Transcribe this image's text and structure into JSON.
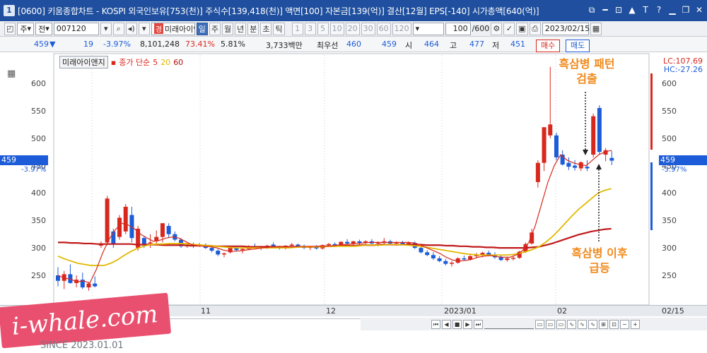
{
  "window": {
    "id_badge": "1",
    "title": "[0600] 키움종합차트 - KOSPI 외국인보유[753(천)] 주식수[139,418(천)] 액면[100] 자본금[139(억)] 결산[12월] EPS[-140] 시가총액[640(억)]",
    "controls": [
      "⧉",
      "━",
      "⊡",
      "▲",
      "T",
      "?",
      "▁",
      "❐",
      "✕"
    ]
  },
  "toolbar": {
    "period_select": "주",
    "jeon_select": "전",
    "stock_code": "007120",
    "gyung_badge": "경",
    "stock_name": "미래아이앤",
    "period_buttons": [
      "일",
      "주",
      "월",
      "년",
      "분",
      "초",
      "틱"
    ],
    "active_period": "일",
    "interval_buttons": [
      "1",
      "3",
      "5",
      "10",
      "20",
      "30",
      "60",
      "120"
    ],
    "count": "100",
    "count_total": "/600",
    "date": "2023/02/15"
  },
  "info": {
    "price": "459",
    "change": "19",
    "change_pct": "-3.97%",
    "volume": "8,101,248",
    "vol_ratio": "73.41%",
    "turnover": "5.81%",
    "amount": "3,733백만",
    "best_bid_label": "최우선",
    "best_ask": "460",
    "best_bid": "459",
    "open_label": "시",
    "open": "464",
    "high_label": "고",
    "high": "477",
    "low_label": "저",
    "low": "451",
    "buy_label": "매수",
    "sell_label": "매도"
  },
  "legend": {
    "name": "미래아이앤지",
    "ma_label": "종가 단순",
    "ma5": "5",
    "ma20": "20",
    "ma60": "60"
  },
  "price_axis": {
    "ticks": [
      "600",
      "550",
      "500",
      "450",
      "400",
      "350",
      "300",
      "250"
    ],
    "current_price": "459",
    "current_change": "-3.97%"
  },
  "lc_hc": {
    "lc": "LC:107.69",
    "hc": "HC:-27.26"
  },
  "date_axis": [
    "11",
    "12",
    "2023/01",
    "02",
    "02/15"
  ],
  "annotations": {
    "pattern_detected": "흑삼병 패턴\n검출",
    "after_surge": "흑삼병 이후\n급등"
  },
  "watermark": {
    "text": "i-whale.com",
    "since": "SINCE 2023.01.01"
  },
  "colors": {
    "title_bg": "#1f4f9e",
    "up": "#d8281e",
    "down": "#1c5cd8",
    "ma5": "#d8281e",
    "ma20": "#e3b800",
    "ma60": "#c0191a",
    "annotation": "#f08a1c",
    "watermark_bg": "#e9506f"
  },
  "chart_data": {
    "type": "candlestick",
    "y_range": [
      210,
      640
    ],
    "candles": [
      {
        "o": 250,
        "h": 265,
        "l": 230,
        "c": 240
      },
      {
        "o": 240,
        "h": 258,
        "l": 225,
        "c": 252
      },
      {
        "o": 252,
        "h": 270,
        "l": 235,
        "c": 236
      },
      {
        "o": 236,
        "h": 250,
        "l": 228,
        "c": 242
      },
      {
        "o": 242,
        "h": 255,
        "l": 225,
        "c": 228
      },
      {
        "o": 228,
        "h": 238,
        "l": 222,
        "c": 235
      },
      {
        "o": 235,
        "h": 248,
        "l": 228,
        "c": 230
      },
      {
        "o": 306,
        "h": 312,
        "l": 300,
        "c": 306
      },
      {
        "o": 310,
        "h": 395,
        "l": 305,
        "c": 390
      },
      {
        "o": 330,
        "h": 335,
        "l": 300,
        "c": 308
      },
      {
        "o": 320,
        "h": 360,
        "l": 315,
        "c": 355
      },
      {
        "o": 330,
        "h": 380,
        "l": 325,
        "c": 375
      },
      {
        "o": 360,
        "h": 375,
        "l": 310,
        "c": 318
      },
      {
        "o": 300,
        "h": 340,
        "l": 295,
        "c": 335
      },
      {
        "o": 318,
        "h": 322,
        "l": 300,
        "c": 305
      },
      {
        "o": 308,
        "h": 325,
        "l": 300,
        "c": 310
      },
      {
        "o": 312,
        "h": 332,
        "l": 305,
        "c": 320
      },
      {
        "o": 320,
        "h": 345,
        "l": 310,
        "c": 345
      },
      {
        "o": 340,
        "h": 345,
        "l": 318,
        "c": 325
      },
      {
        "o": 325,
        "h": 330,
        "l": 312,
        "c": 315
      },
      {
        "o": 315,
        "h": 318,
        "l": 300,
        "c": 303
      },
      {
        "o": 303,
        "h": 310,
        "l": 300,
        "c": 306
      },
      {
        "o": 306,
        "h": 310,
        "l": 300,
        "c": 304
      },
      {
        "o": 305,
        "h": 309,
        "l": 302,
        "c": 306
      },
      {
        "o": 305,
        "h": 308,
        "l": 298,
        "c": 300
      },
      {
        "o": 300,
        "h": 304,
        "l": 292,
        "c": 295
      },
      {
        "o": 295,
        "h": 298,
        "l": 285,
        "c": 288
      },
      {
        "o": 288,
        "h": 292,
        "l": 283,
        "c": 290
      },
      {
        "o": 292,
        "h": 302,
        "l": 290,
        "c": 300
      },
      {
        "o": 300,
        "h": 303,
        "l": 294,
        "c": 296
      },
      {
        "o": 296,
        "h": 300,
        "l": 290,
        "c": 298
      },
      {
        "o": 298,
        "h": 305,
        "l": 296,
        "c": 303
      },
      {
        "o": 303,
        "h": 308,
        "l": 299,
        "c": 300
      },
      {
        "o": 300,
        "h": 304,
        "l": 296,
        "c": 302
      },
      {
        "o": 302,
        "h": 306,
        "l": 298,
        "c": 304
      },
      {
        "o": 306,
        "h": 310,
        "l": 300,
        "c": 302
      },
      {
        "o": 302,
        "h": 304,
        "l": 297,
        "c": 299
      },
      {
        "o": 299,
        "h": 305,
        "l": 297,
        "c": 304
      },
      {
        "o": 304,
        "h": 309,
        "l": 301,
        "c": 306
      },
      {
        "o": 306,
        "h": 308,
        "l": 302,
        "c": 303
      },
      {
        "o": 303,
        "h": 306,
        "l": 298,
        "c": 300
      },
      {
        "o": 300,
        "h": 304,
        "l": 296,
        "c": 302
      },
      {
        "o": 302,
        "h": 305,
        "l": 297,
        "c": 299
      },
      {
        "o": 299,
        "h": 306,
        "l": 297,
        "c": 305
      },
      {
        "o": 305,
        "h": 309,
        "l": 302,
        "c": 307
      },
      {
        "o": 307,
        "h": 310,
        "l": 302,
        "c": 304
      },
      {
        "o": 304,
        "h": 312,
        "l": 303,
        "c": 311
      },
      {
        "o": 311,
        "h": 316,
        "l": 305,
        "c": 308
      },
      {
        "o": 308,
        "h": 313,
        "l": 305,
        "c": 312
      },
      {
        "o": 312,
        "h": 315,
        "l": 306,
        "c": 309
      },
      {
        "o": 309,
        "h": 314,
        "l": 305,
        "c": 312
      },
      {
        "o": 312,
        "h": 316,
        "l": 307,
        "c": 308
      },
      {
        "o": 308,
        "h": 312,
        "l": 303,
        "c": 310
      },
      {
        "o": 310,
        "h": 318,
        "l": 306,
        "c": 312
      },
      {
        "o": 312,
        "h": 315,
        "l": 306,
        "c": 308
      },
      {
        "o": 308,
        "h": 312,
        "l": 304,
        "c": 310
      },
      {
        "o": 310,
        "h": 313,
        "l": 305,
        "c": 307
      },
      {
        "o": 307,
        "h": 312,
        "l": 304,
        "c": 309
      },
      {
        "o": 309,
        "h": 312,
        "l": 298,
        "c": 300
      },
      {
        "o": 300,
        "h": 304,
        "l": 290,
        "c": 292
      },
      {
        "o": 292,
        "h": 296,
        "l": 285,
        "c": 287
      },
      {
        "o": 287,
        "h": 292,
        "l": 278,
        "c": 281
      },
      {
        "o": 281,
        "h": 285,
        "l": 274,
        "c": 276
      },
      {
        "o": 276,
        "h": 280,
        "l": 268,
        "c": 271
      },
      {
        "o": 271,
        "h": 276,
        "l": 266,
        "c": 273
      },
      {
        "o": 273,
        "h": 283,
        "l": 271,
        "c": 281
      },
      {
        "o": 281,
        "h": 286,
        "l": 277,
        "c": 279
      },
      {
        "o": 279,
        "h": 287,
        "l": 277,
        "c": 285
      },
      {
        "o": 285,
        "h": 291,
        "l": 281,
        "c": 287
      },
      {
        "o": 287,
        "h": 293,
        "l": 283,
        "c": 291
      },
      {
        "o": 291,
        "h": 295,
        "l": 285,
        "c": 288
      },
      {
        "o": 288,
        "h": 292,
        "l": 280,
        "c": 283
      },
      {
        "o": 283,
        "h": 288,
        "l": 276,
        "c": 278
      },
      {
        "o": 278,
        "h": 284,
        "l": 275,
        "c": 281
      },
      {
        "o": 281,
        "h": 285,
        "l": 277,
        "c": 282
      },
      {
        "o": 282,
        "h": 295,
        "l": 280,
        "c": 293
      },
      {
        "o": 293,
        "h": 310,
        "l": 291,
        "c": 307
      },
      {
        "o": 308,
        "h": 335,
        "l": 306,
        "c": 328
      },
      {
        "o": 420,
        "h": 460,
        "l": 410,
        "c": 455
      },
      {
        "o": 455,
        "h": 520,
        "l": 440,
        "c": 520
      },
      {
        "o": 505,
        "h": 630,
        "l": 500,
        "c": 525
      },
      {
        "o": 505,
        "h": 510,
        "l": 460,
        "c": 465
      },
      {
        "o": 470,
        "h": 478,
        "l": 450,
        "c": 452
      },
      {
        "o": 455,
        "h": 465,
        "l": 442,
        "c": 448
      },
      {
        "o": 450,
        "h": 460,
        "l": 441,
        "c": 446
      },
      {
        "o": 445,
        "h": 458,
        "l": 440,
        "c": 456
      },
      {
        "o": 448,
        "h": 460,
        "l": 440,
        "c": 445
      },
      {
        "o": 470,
        "h": 545,
        "l": 465,
        "c": 540
      },
      {
        "o": 555,
        "h": 560,
        "l": 470,
        "c": 475
      },
      {
        "o": 470,
        "h": 482,
        "l": 458,
        "c": 478
      },
      {
        "o": 464,
        "h": 477,
        "l": 451,
        "c": 459
      }
    ],
    "ma5": [
      250,
      245,
      243,
      238,
      240,
      236,
      260,
      290,
      315,
      333,
      345,
      342,
      335,
      325,
      318,
      312,
      314,
      318,
      320,
      318,
      312,
      306,
      304,
      303,
      302,
      300,
      296,
      294,
      294,
      295,
      297,
      298,
      300,
      301,
      302,
      302,
      302,
      302,
      303,
      303,
      303,
      303,
      303,
      304,
      305,
      306,
      307,
      308,
      309,
      310,
      310,
      310,
      310,
      310,
      310,
      310,
      309,
      305,
      300,
      295,
      290,
      283,
      278,
      276,
      277,
      279,
      283,
      285,
      286,
      284,
      283,
      283,
      287,
      295,
      310,
      340,
      380,
      420,
      450,
      470,
      460,
      455,
      452,
      450,
      460,
      470,
      475,
      478
    ],
    "ma20": [
      285,
      280,
      276,
      272,
      270,
      268,
      268,
      268,
      272,
      278,
      286,
      293,
      299,
      303,
      306,
      307,
      307,
      308,
      308,
      308,
      307,
      306,
      305,
      304,
      303,
      302,
      301,
      300,
      300,
      300,
      300,
      300,
      300,
      300,
      300,
      300,
      301,
      302,
      302,
      302,
      302,
      303,
      303,
      303,
      303,
      303,
      304,
      305,
      305,
      305,
      306,
      306,
      306,
      305,
      304,
      303,
      301,
      299,
      297,
      295,
      293,
      291,
      289,
      288,
      287,
      287,
      287,
      287,
      287,
      288,
      290,
      293,
      297,
      302,
      310,
      320,
      332,
      345,
      358,
      370,
      380,
      390,
      400,
      405,
      408
    ],
    "ma60": [
      310,
      310,
      309,
      309,
      308,
      308,
      307,
      307,
      307,
      307,
      307,
      307,
      306,
      306,
      306,
      306,
      305,
      305,
      305,
      305,
      304,
      304,
      304,
      304,
      303,
      303,
      303,
      303,
      303,
      302,
      302,
      302,
      302,
      302,
      302,
      302,
      302,
      302,
      302,
      302,
      303,
      303,
      303,
      304,
      304,
      304,
      305,
      305,
      305,
      306,
      306,
      306,
      306,
      306,
      306,
      306,
      305,
      305,
      305,
      304,
      304,
      303,
      303,
      302,
      302,
      301,
      301,
      300,
      300,
      300,
      300,
      300,
      301,
      302,
      305,
      308,
      312,
      316,
      320,
      324,
      327,
      330,
      332,
      334,
      335
    ]
  }
}
